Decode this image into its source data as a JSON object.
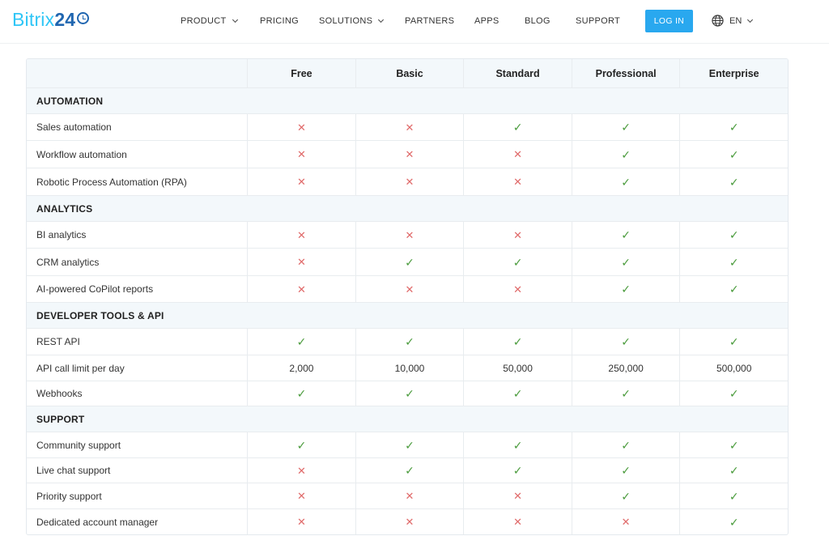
{
  "brand": {
    "name": "Bitrix",
    "number": "24"
  },
  "nav": [
    {
      "label": "PRODUCT",
      "dropdown": true
    },
    {
      "label": "PRICING",
      "dropdown": false
    },
    {
      "label": "SOLUTIONS",
      "dropdown": true
    },
    {
      "label": "PARTNERS",
      "dropdown": false
    },
    {
      "label": "APPS",
      "dropdown": false
    },
    {
      "label": "BLOG",
      "dropdown": false
    },
    {
      "label": "SUPPORT",
      "dropdown": false
    }
  ],
  "login_label": "LOG IN",
  "language": "EN",
  "colors": {
    "accent": "#29a8ef",
    "check": "#4a9b3c",
    "cross": "#e06a6a",
    "section_bg": "#f3f8fb"
  },
  "plans": [
    "Free",
    "Basic",
    "Standard",
    "Professional",
    "Enterprise"
  ],
  "sections": [
    {
      "title": "AUTOMATION",
      "rows": [
        {
          "feature": "Sales automation",
          "values": [
            "no",
            "no",
            "yes",
            "yes",
            "yes"
          ]
        },
        {
          "feature": "Workflow automation",
          "values": [
            "no",
            "no",
            "no",
            "yes",
            "yes"
          ]
        },
        {
          "feature": "Robotic Process Automation (RPA)",
          "values": [
            "no",
            "no",
            "no",
            "yes",
            "yes"
          ]
        }
      ]
    },
    {
      "title": "ANALYTICS",
      "rows": [
        {
          "feature": "BI analytics",
          "values": [
            "no",
            "no",
            "no",
            "yes",
            "yes"
          ]
        },
        {
          "feature": "CRM analytics",
          "values": [
            "no",
            "yes",
            "yes",
            "yes",
            "yes"
          ]
        },
        {
          "feature": "AI-powered CoPilot reports",
          "values": [
            "no",
            "no",
            "no",
            "yes",
            "yes"
          ]
        }
      ]
    },
    {
      "title": "DEVELOPER TOOLS & API",
      "rows": [
        {
          "feature": "REST API",
          "values": [
            "yes",
            "yes",
            "yes",
            "yes",
            "yes"
          ]
        },
        {
          "feature": "API call limit per day",
          "values": [
            "2,000",
            "10,000",
            "50,000",
            "250,000",
            "500,000"
          ]
        },
        {
          "feature": "Webhooks",
          "values": [
            "yes",
            "yes",
            "yes",
            "yes",
            "yes"
          ]
        }
      ]
    },
    {
      "title": "SUPPORT",
      "rows": [
        {
          "feature": "Community support",
          "values": [
            "yes",
            "yes",
            "yes",
            "yes",
            "yes"
          ]
        },
        {
          "feature": "Live chat support",
          "values": [
            "no",
            "yes",
            "yes",
            "yes",
            "yes"
          ]
        },
        {
          "feature": "Priority support",
          "values": [
            "no",
            "no",
            "no",
            "yes",
            "yes"
          ]
        },
        {
          "feature": "Dedicated account manager",
          "values": [
            "no",
            "no",
            "no",
            "no",
            "yes"
          ]
        }
      ]
    }
  ]
}
